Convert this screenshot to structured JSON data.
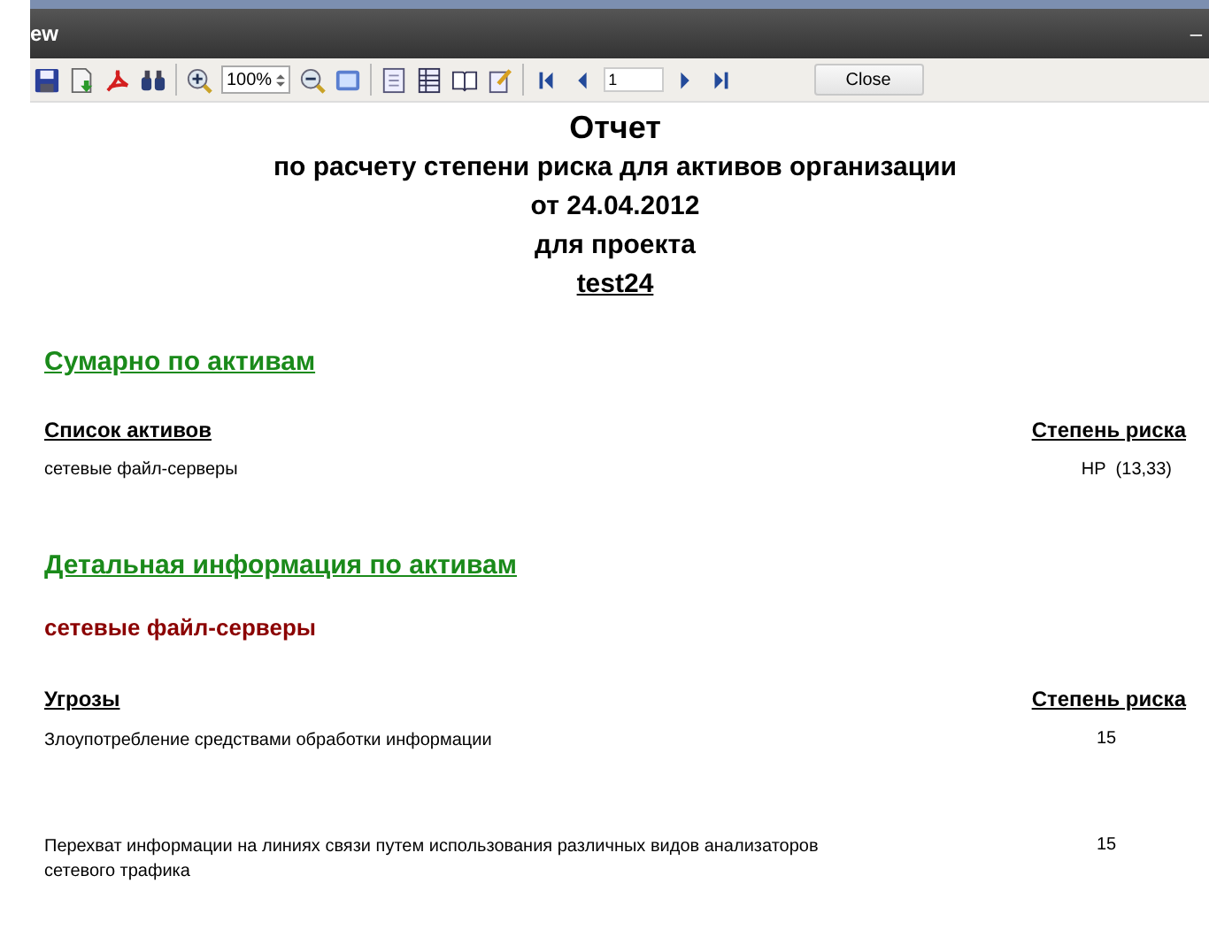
{
  "window": {
    "title": "ew",
    "minimize": "–"
  },
  "toolbar": {
    "zoom": "100%",
    "page": "1",
    "close": "Close"
  },
  "report": {
    "title": "Отчет",
    "subtitle": [
      "по расчету степени риска для активов организации",
      "от 24.04.2012",
      "для проекта"
    ],
    "project": "test24",
    "summary": {
      "heading": "Сумарно по активам",
      "columns": [
        "Список активов",
        "Степень риска"
      ],
      "rows": [
        {
          "name": "сетевые файл-серверы",
          "risk": "НР  (13,33)"
        }
      ]
    },
    "details": {
      "heading": "Детальная информация по активам",
      "asset": "сетевые файл-серверы",
      "columns": [
        "Угрозы",
        "Степень риска"
      ],
      "rows": [
        {
          "name": "Злоупотребление средствами обработки информации",
          "risk": "15"
        },
        {
          "name": "Перехват информации на линиях связи путем использования различных видов анализаторов сетевого трафика",
          "risk": "15"
        }
      ]
    }
  }
}
